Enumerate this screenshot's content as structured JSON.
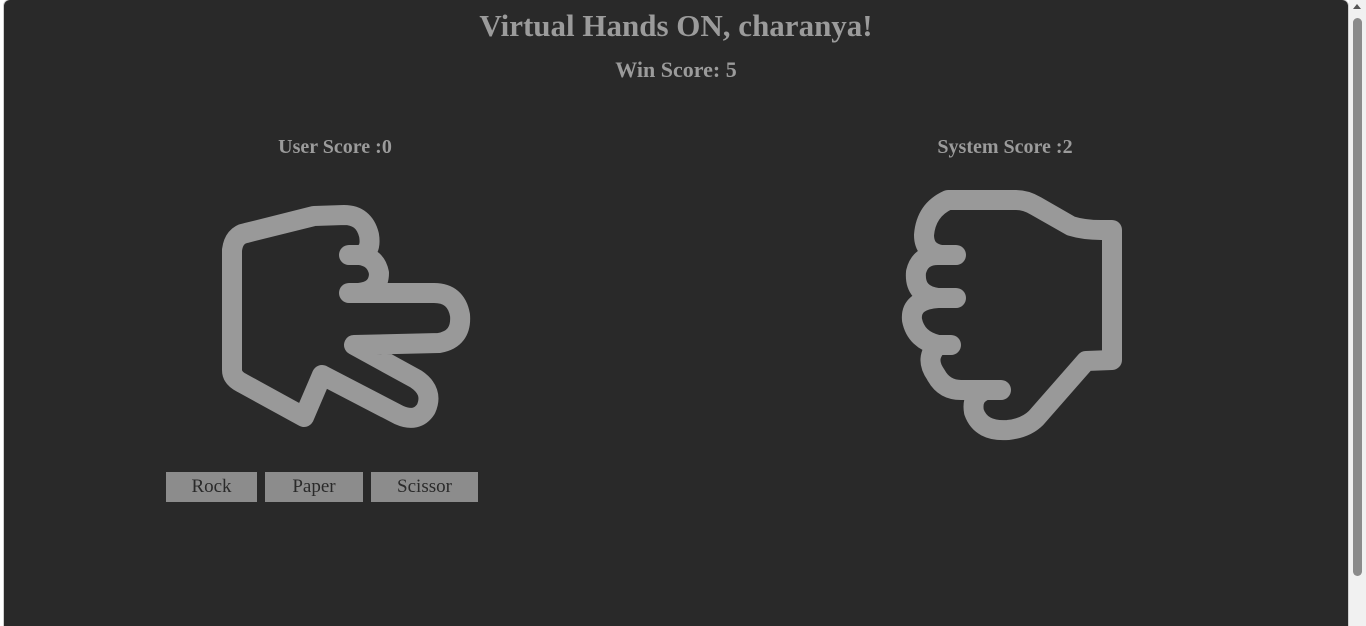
{
  "header": {
    "title": "Virtual Hands ON, charanya!",
    "win_score": "Win Score: 5"
  },
  "user": {
    "score_label": "User Score :0",
    "hand_icon": "scissors-hand-icon"
  },
  "system": {
    "score_label": "System Score :2",
    "hand_icon": "rock-fist-icon"
  },
  "choices": {
    "rock": "Rock",
    "paper": "Paper",
    "scissor": "Scissor"
  },
  "colors": {
    "background": "#292929",
    "text": "#9b9b9b",
    "hand_stroke": "#999999",
    "button_bg": "#8c8c8c"
  }
}
